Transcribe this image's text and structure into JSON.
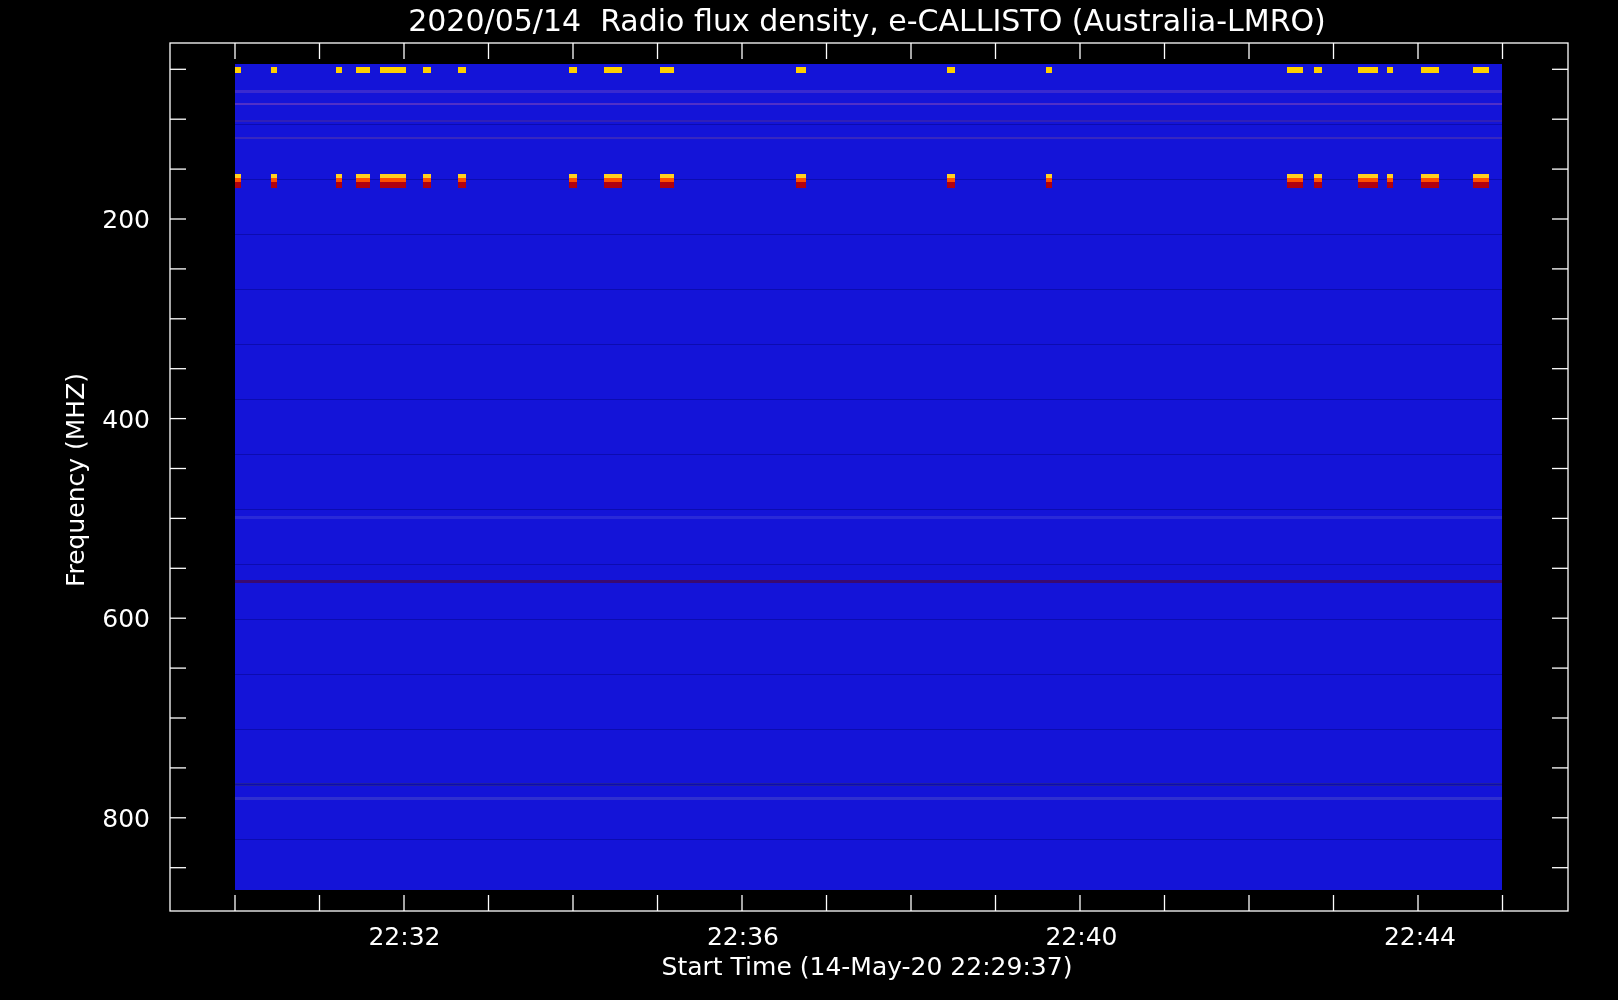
{
  "title": "2020/05/14  Radio flux density, e-CALLISTO (Australia-LMRO)",
  "y_axis": {
    "label": "Frequency (MHZ)",
    "ticks": [
      "200",
      "400",
      "600",
      "800"
    ]
  },
  "x_axis": {
    "label": "Start Time (14-May-20 22:29:37)",
    "ticks": [
      "22:32",
      "22:36",
      "22:40",
      "22:44"
    ]
  }
}
